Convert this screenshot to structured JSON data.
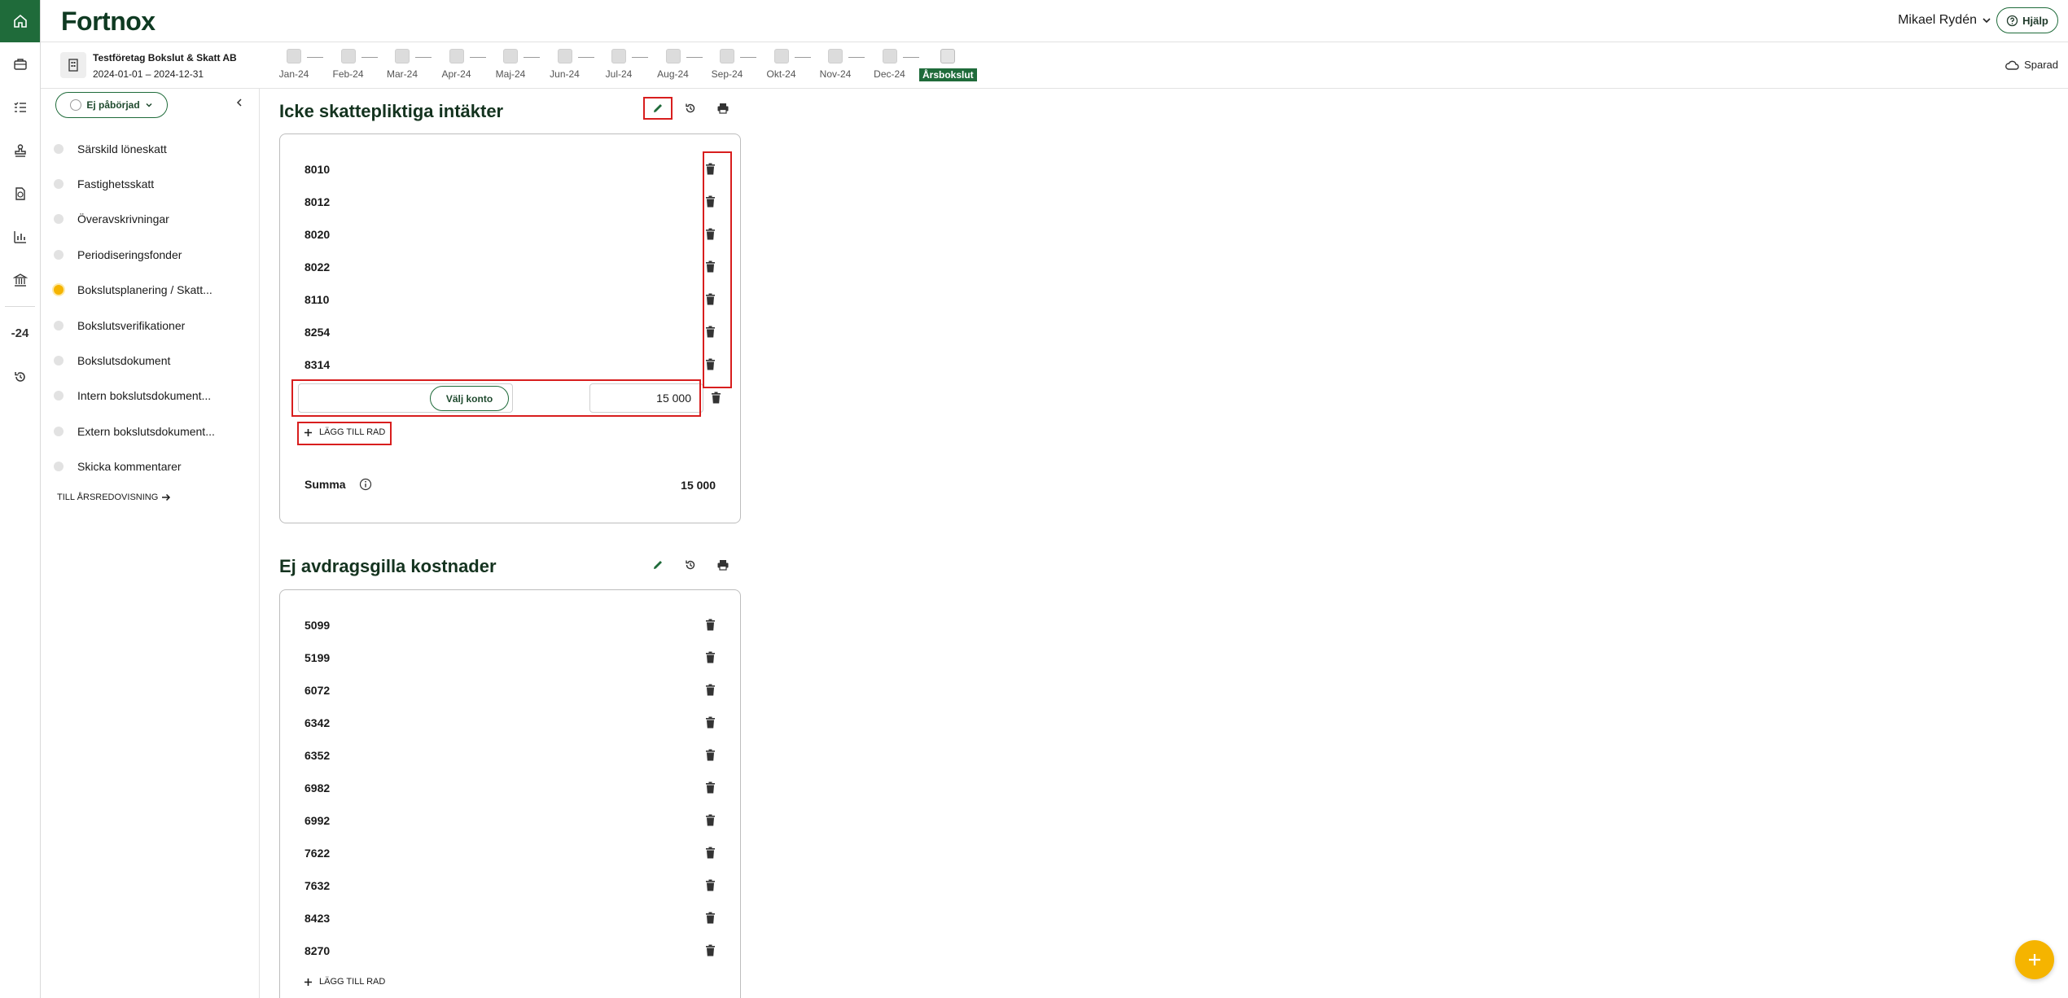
{
  "rail": {
    "items": [
      {
        "name": "home-icon"
      },
      {
        "name": "briefcase-icon"
      },
      {
        "name": "checklist-icon"
      },
      {
        "name": "stamp-icon"
      },
      {
        "name": "document-money-icon"
      },
      {
        "name": "bar-chart-icon"
      },
      {
        "name": "bank-icon"
      }
    ],
    "year_label": "-24",
    "history_icon": "history-icon"
  },
  "header": {
    "logo": "Fortnox",
    "user_name": "Mikael Rydén",
    "help_label": "Hjälp"
  },
  "subheader": {
    "company_name": "Testföretag Bokslut & Skatt AB",
    "period": "2024-01-01 – 2024-12-31",
    "months": [
      "Jan-24",
      "Feb-24",
      "Mar-24",
      "Apr-24",
      "Maj-24",
      "Jun-24",
      "Jul-24",
      "Aug-24",
      "Sep-24",
      "Okt-24",
      "Nov-24",
      "Dec-24",
      "Årsbokslut"
    ],
    "active_month": "Årsbokslut",
    "saved_label": "Sparad"
  },
  "sidebar": {
    "status_label": "Ej påbörjad",
    "steps": [
      {
        "label": "Särskild löneskatt"
      },
      {
        "label": "Fastighetsskatt"
      },
      {
        "label": "Överavskrivningar"
      },
      {
        "label": "Periodiseringsfonder"
      },
      {
        "label": "Bokslutsplanering / Skatt..."
      },
      {
        "label": "Bokslutsverifikationer"
      },
      {
        "label": "Bokslutsdokument"
      },
      {
        "label": "Intern bokslutsdokument..."
      },
      {
        "label": "Extern bokslutsdokument..."
      },
      {
        "label": "Skicka kommentarer"
      }
    ],
    "active_step": "Bokslutsplanering / Skatt...",
    "to_arsredovisning": "TILL ÅRSREDOVISNING"
  },
  "section1": {
    "title": "Icke skattepliktiga intäkter",
    "accounts": [
      "8010",
      "8012",
      "8020",
      "8022",
      "8110",
      "8254",
      "8314"
    ],
    "new_row": {
      "account_value": "",
      "choose_account_label": "Välj konto",
      "amount": "15 000"
    },
    "add_row_label": "LÄGG TILL RAD",
    "sum_label": "Summa",
    "sum_value": "15 000"
  },
  "section2": {
    "title": "Ej avdragsgilla kostnader",
    "accounts": [
      "5099",
      "5199",
      "6072",
      "6342",
      "6352",
      "6982",
      "6992",
      "7622",
      "7632",
      "8423",
      "8270"
    ],
    "add_row_label": "LÄGG TILL RAD"
  },
  "colors": {
    "brand_green": "#1f6b3a",
    "highlight_red": "#d81e1e",
    "active_yellow": "#f5b400"
  }
}
